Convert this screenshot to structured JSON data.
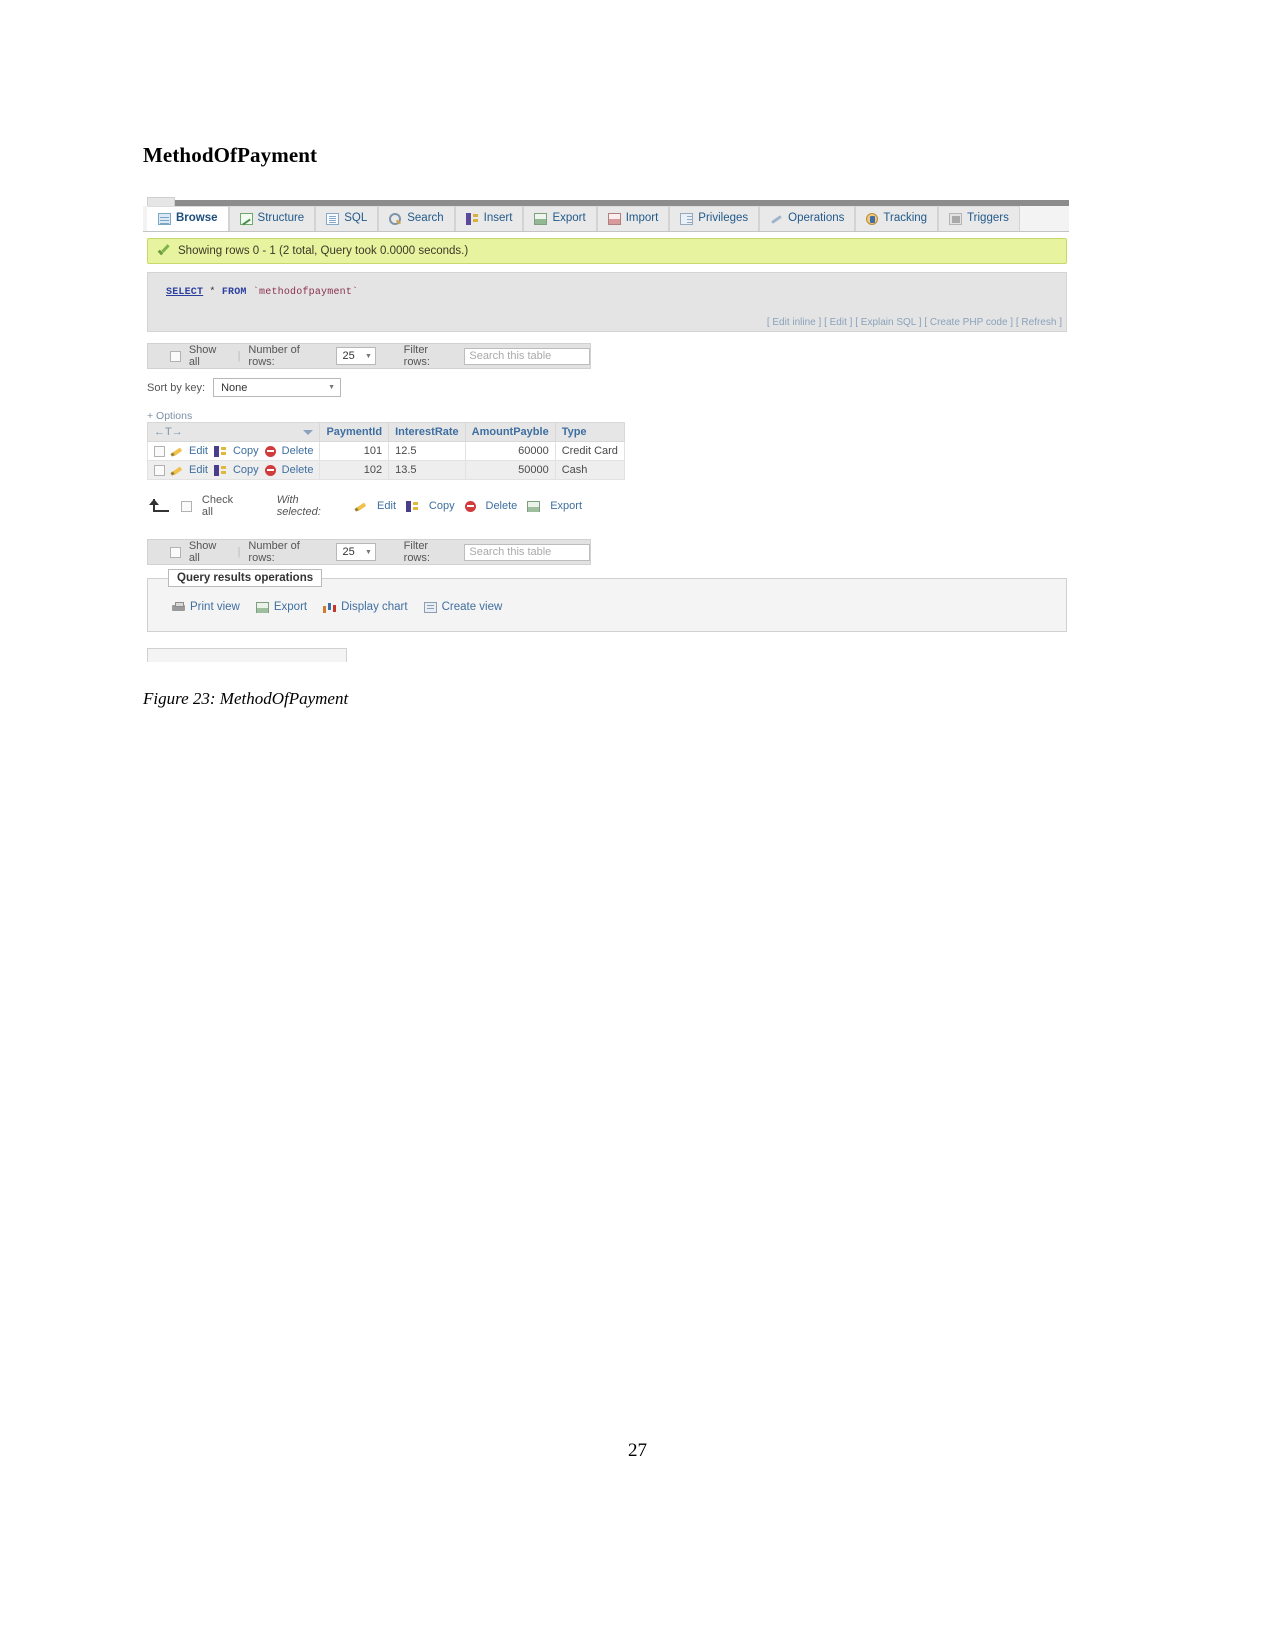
{
  "document": {
    "title": "MethodOfPayment",
    "caption": "Figure 23: MethodOfPayment",
    "page_number": "27"
  },
  "screenshot": {
    "tabs": [
      {
        "label": "Browse",
        "icon": "browse-icon",
        "active": true
      },
      {
        "label": "Structure",
        "icon": "structure-icon",
        "active": false
      },
      {
        "label": "SQL",
        "icon": "sql-icon",
        "active": false
      },
      {
        "label": "Search",
        "icon": "search-icon",
        "active": false
      },
      {
        "label": "Insert",
        "icon": "insert-icon",
        "active": false
      },
      {
        "label": "Export",
        "icon": "export-icon",
        "active": false
      },
      {
        "label": "Import",
        "icon": "import-icon",
        "active": false
      },
      {
        "label": "Privileges",
        "icon": "privileges-icon",
        "active": false
      },
      {
        "label": "Operations",
        "icon": "operations-icon",
        "active": false
      },
      {
        "label": "Tracking",
        "icon": "tracking-icon",
        "active": false
      },
      {
        "label": "Triggers",
        "icon": "triggers-icon",
        "active": false
      }
    ],
    "banner": {
      "message": "Showing rows 0 - 1 (2 total, Query took 0.0000 seconds.)"
    },
    "sql": {
      "keyword": "SELECT",
      "star": "*",
      "from": "FROM",
      "table": "`methodofpayment`",
      "actions": [
        "[ Edit inline ]",
        "[ Edit ]",
        "[ Explain SQL ]",
        "[ Create PHP code ]",
        "[ Refresh ]"
      ]
    },
    "options_bar": {
      "show_all_label": "Show all",
      "number_of_rows_label": "Number of rows:",
      "number_of_rows_value": "25",
      "filter_rows_label": "Filter rows:",
      "filter_placeholder": "Search this table"
    },
    "sort": {
      "label": "Sort by key:",
      "value": "None"
    },
    "options_toggle": "+ Options",
    "table": {
      "control_header": "←T→",
      "columns": [
        "PaymentId",
        "InterestRate",
        "AmountPayble",
        "Type"
      ],
      "row_actions": [
        "Edit",
        "Copy",
        "Delete"
      ],
      "rows": [
        {
          "PaymentId": "101",
          "InterestRate": "12.5",
          "AmountPayble": "60000",
          "Type": "Credit Card"
        },
        {
          "PaymentId": "102",
          "InterestRate": "13.5",
          "AmountPayble": "50000",
          "Type": "Cash"
        }
      ]
    },
    "with_selected": {
      "check_all": "Check all",
      "label": "With selected:",
      "actions": [
        "Edit",
        "Copy",
        "Delete",
        "Export"
      ]
    },
    "query_results_operations": {
      "legend": "Query results operations",
      "links": [
        "Print view",
        "Export",
        "Display chart",
        "Create view"
      ]
    }
  }
}
